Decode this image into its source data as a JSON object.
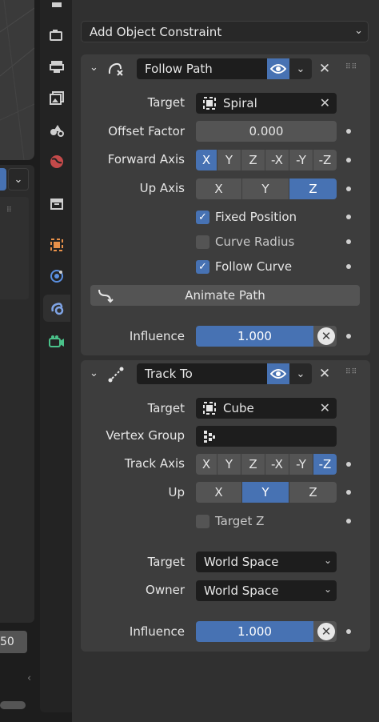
{
  "add_constraint": {
    "label": "Add Object Constraint"
  },
  "follow_path": {
    "name": "Follow Path",
    "target_label": "Target",
    "target_value": "Spiral",
    "offset_label": "Offset Factor",
    "offset_value": "0.000",
    "forward_label": "Forward Axis",
    "forward_options": [
      "X",
      "Y",
      "Z",
      "-X",
      "-Y",
      "-Z"
    ],
    "forward_selected": "X",
    "up_label": "Up Axis",
    "up_options": [
      "X",
      "Y",
      "Z"
    ],
    "up_selected": "Z",
    "fixed_position": {
      "label": "Fixed Position",
      "checked": true
    },
    "curve_radius": {
      "label": "Curve Radius",
      "checked": false
    },
    "follow_curve": {
      "label": "Follow Curve",
      "checked": true
    },
    "animate_label": "Animate Path",
    "influence_label": "Influence",
    "influence_value": "1.000",
    "influence_fraction": 1.0
  },
  "track_to": {
    "name": "Track To",
    "target_label": "Target",
    "target_value": "Cube",
    "vgroup_label": "Vertex Group",
    "vgroup_value": "",
    "track_label": "Track Axis",
    "track_options": [
      "X",
      "Y",
      "Z",
      "-X",
      "-Y",
      "-Z"
    ],
    "track_selected": "-Z",
    "up_label": "Up",
    "up_options": [
      "X",
      "Y",
      "Z"
    ],
    "up_selected": "Y",
    "target_z": {
      "label": "Target Z",
      "checked": false
    },
    "target_space_label": "Target",
    "target_space_value": "World Space",
    "owner_space_label": "Owner",
    "owner_space_value": "World Space",
    "influence_label": "Influence",
    "influence_value": "1.000",
    "influence_fraction": 1.0
  },
  "left": {
    "number_field": "50"
  },
  "colors": {
    "accent": "#4772b3",
    "panel": "#3d3d3d",
    "bg": "#303030"
  }
}
